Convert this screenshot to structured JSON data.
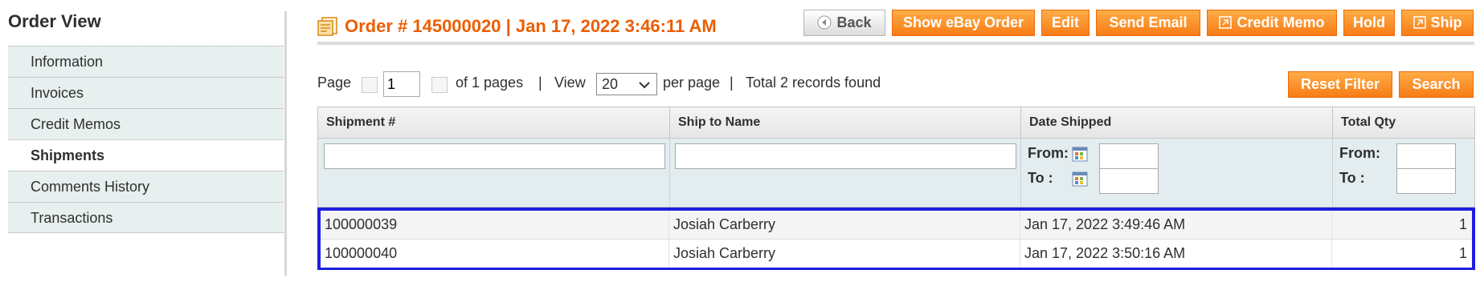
{
  "sidebar": {
    "title": "Order View",
    "items": [
      {
        "label": "Information"
      },
      {
        "label": "Invoices"
      },
      {
        "label": "Credit Memos"
      },
      {
        "label": "Shipments",
        "active": true
      },
      {
        "label": "Comments History"
      },
      {
        "label": "Transactions"
      }
    ]
  },
  "header": {
    "title": "Order # 145000020 | Jan 17, 2022 3:46:11 AM",
    "buttons": {
      "back": "Back",
      "show_ebay": "Show eBay Order",
      "edit": "Edit",
      "send_email": "Send Email",
      "credit_memo": "Credit Memo",
      "hold": "Hold",
      "ship": "Ship"
    }
  },
  "pager": {
    "page_label": "Page",
    "page_value": "1",
    "of_pages": "of 1 pages",
    "separator": "|",
    "view_label": "View",
    "view_value": "20",
    "per_page": "per page",
    "total": "Total 2 records found"
  },
  "grid_actions": {
    "reset_filter": "Reset Filter",
    "search": "Search"
  },
  "grid": {
    "columns": [
      "Shipment #",
      "Ship to Name",
      "Date Shipped",
      "Total Qty"
    ],
    "filters": {
      "from_label": "From:",
      "to_label": "To :"
    },
    "rows": [
      {
        "shipment": "100000039",
        "name": "Josiah Carberry",
        "date": "Jan 17, 2022 3:49:46 AM",
        "qty": "1"
      },
      {
        "shipment": "100000040",
        "name": "Josiah Carberry",
        "date": "Jan 17, 2022 3:50:16 AM",
        "qty": "1"
      }
    ]
  },
  "colors": {
    "accent_orange": "#eb5e00",
    "button_orange": "#f77c16",
    "highlight_border": "#1e1ee0",
    "nav_bg": "#e7efef"
  },
  "icons": {
    "order": "order-document-icon",
    "back": "back-arrow-icon",
    "credit_memo": "credit-memo-icon",
    "ship": "ship-icon",
    "calendar": "calendar-icon"
  }
}
